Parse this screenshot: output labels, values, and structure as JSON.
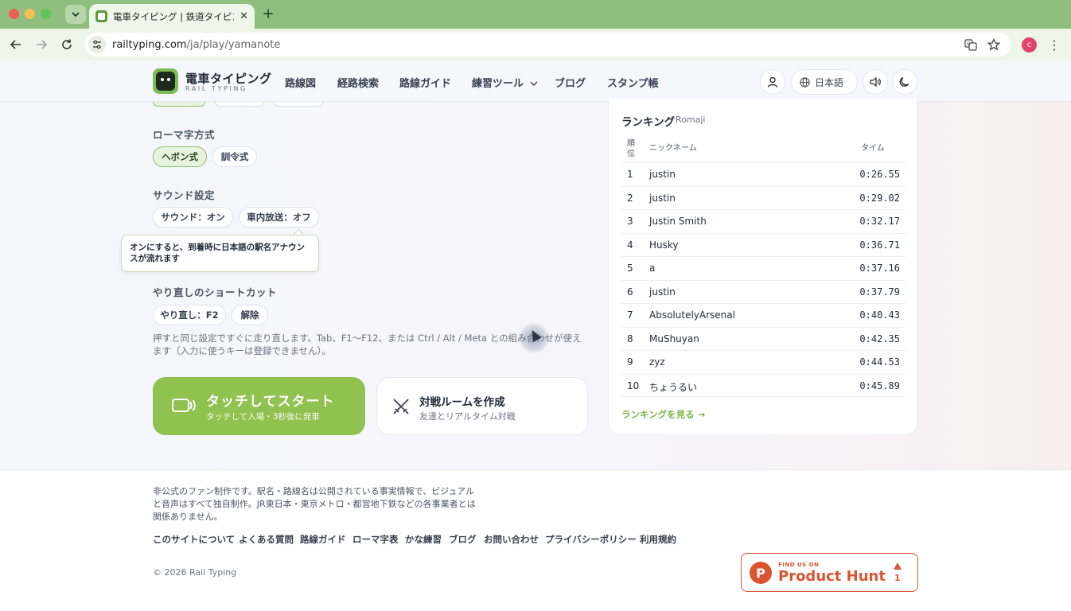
{
  "browser": {
    "tab_title": "電車タイピング | 鉄道タイピン",
    "tab_close": "✕",
    "new_tab": "+",
    "url_host": "railtyping.com",
    "url_path": "/ja/play/yamanote",
    "profile_initial": "c",
    "menu_glyph": "⋮"
  },
  "header": {
    "logo_title": "電車タイピング",
    "logo_subtitle": "RAIL TYPING",
    "nav": [
      "路線図",
      "経路検索",
      "路線ガイド",
      "練習ツール",
      "ブログ",
      "スタンプ帳"
    ],
    "language": "日本語"
  },
  "settings": {
    "romaji_label": "ローマ字方式",
    "romaji_options": [
      "ヘボン式",
      "訓令式"
    ],
    "sound_label": "サウンド設定",
    "sound_options": [
      "サウンド：オン",
      "車内放送：オフ"
    ],
    "tooltip": "オンにすると、到着時に日本語の駅名アナウンスが流れます",
    "retry_label": "やり直しのショートカット",
    "retry_options": [
      "やり直し：F2",
      "解除"
    ],
    "help_text": "押すと同じ設定ですぐに走り直します。Tab、F1〜F12、または Ctrl / Alt / Meta との組み合わせが使えます（入力に使うキーは登録できません）。"
  },
  "actions": {
    "start_title": "タッチしてスタート",
    "start_sub": "タッチして入場・3秒後に発車",
    "battle_title": "対戦ルームを作成",
    "battle_sub": "友達とリアルタイム対戦"
  },
  "ranking": {
    "title": "ランキング",
    "mode": "Romaji",
    "col_rank": "順\n位",
    "col_name": "ニックネーム",
    "col_time": "タイム",
    "rows": [
      {
        "rank": "1",
        "name": "justin",
        "time": "0:26.55"
      },
      {
        "rank": "2",
        "name": "justin",
        "time": "0:29.02"
      },
      {
        "rank": "3",
        "name": "Justin Smith",
        "time": "0:32.17"
      },
      {
        "rank": "4",
        "name": "Husky",
        "time": "0:36.71"
      },
      {
        "rank": "5",
        "name": "a",
        "time": "0:37.16"
      },
      {
        "rank": "6",
        "name": "justin",
        "time": "0:37.79"
      },
      {
        "rank": "7",
        "name": "AbsolutelyArsenal",
        "time": "0:40.43"
      },
      {
        "rank": "8",
        "name": "MuShuyan",
        "time": "0:42.35"
      },
      {
        "rank": "9",
        "name": "zyz",
        "time": "0:44.53"
      },
      {
        "rank": "10",
        "name": "ちょうるい",
        "time": "0:45.89"
      }
    ],
    "see_more": "ランキングを見る →"
  },
  "footer": {
    "disclaimer": "非公式のファン制作です。駅名・路線名は公開されている事実情報で、ビジュアルと音声はすべて独自制作。JR東日本・東京メトロ・都営地下鉄などの各事業者とは関係ありません。",
    "links": [
      "このサイトについて",
      "よくある質問",
      "路線ガイド",
      "ローマ字表",
      "かな練習",
      "ブログ",
      "お問い合わせ",
      "プライバシーポリシー",
      "利用規約"
    ],
    "copyright": "© 2026 Rail Typing",
    "ph_small": "FIND US ON",
    "ph_name": "Product Hunt",
    "ph_count": "1"
  },
  "colors": {
    "accent_green": "#8fc24e",
    "link_green": "#7cb342",
    "product_hunt": "#da552f"
  }
}
